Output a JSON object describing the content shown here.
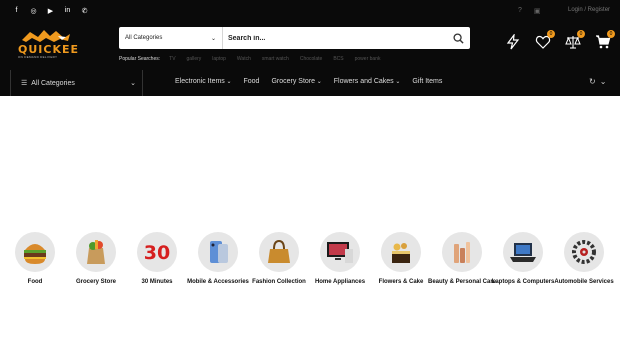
{
  "social": {
    "facebook": "f",
    "instagram": "◎",
    "youtube": "▶",
    "linkedin": "in",
    "whatsapp": "✆"
  },
  "topbar": {
    "login_register": "Login / Register"
  },
  "logo": {
    "word": "QUICKEE",
    "tag": "ON DEMAND DELIVERY"
  },
  "search": {
    "category": "All Categories",
    "placeholder": "Search in...",
    "popular_label": "Popular Searches:",
    "popular": [
      "TV",
      "gallery",
      "laptop",
      "Watch",
      "smart watch",
      "Chocolate",
      "BCS",
      "power bank"
    ]
  },
  "actions": {
    "wishlist_count": "0",
    "compare_count": "0",
    "cart_count": "0"
  },
  "nav": {
    "all_categories": "All Categories",
    "items": [
      {
        "label": "Electronic Items",
        "has_dropdown": true
      },
      {
        "label": "Food",
        "has_dropdown": false
      },
      {
        "label": "Grocery Store",
        "has_dropdown": true
      },
      {
        "label": "Flowers and Cakes",
        "has_dropdown": true
      },
      {
        "label": "Gift Items",
        "has_dropdown": false
      }
    ]
  },
  "categories": [
    {
      "label": "Food",
      "icon": "burger-icon"
    },
    {
      "label": "Grocery Store",
      "icon": "grocery-bag-icon"
    },
    {
      "label": "30 Minutes",
      "icon": "thirty-minutes-icon"
    },
    {
      "label": "Mobile & Accessories",
      "icon": "phone-icon"
    },
    {
      "label": "Fashion Collection",
      "icon": "handbag-icon"
    },
    {
      "label": "Home Appliances",
      "icon": "tv-icon"
    },
    {
      "label": "Flowers & Cake",
      "icon": "cake-icon"
    },
    {
      "label": "Beauty & Personal Care",
      "icon": "cosmetics-icon"
    },
    {
      "label": "Laptops & Computers",
      "icon": "laptop-icon"
    },
    {
      "label": "Automobile Services",
      "icon": "car-parts-icon"
    }
  ],
  "colors": {
    "header_bg": "#0a0a0a",
    "accent": "#f09a1e"
  }
}
